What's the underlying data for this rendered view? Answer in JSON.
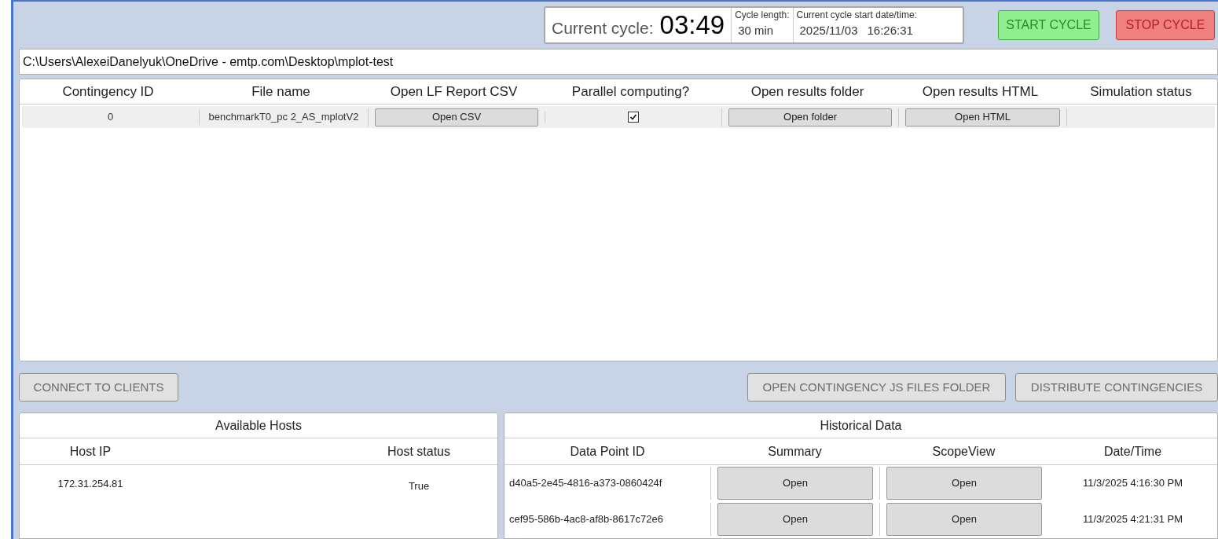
{
  "cycle": {
    "label": "Current cycle:",
    "timer": "03:49",
    "length_label": "Cycle length:",
    "length": "30 min",
    "start_label": "Current cycle start date/time:",
    "start_date": "2025/11/03",
    "start_time": "16:26:31"
  },
  "buttons": {
    "start": "START CYCLE",
    "stop": "STOP CYCLE"
  },
  "path": "C:\\Users\\AlexeiDanelyuk\\OneDrive - emtp.com\\Desktop\\mplot-test",
  "contingency_table": {
    "columns": [
      "Contingency ID",
      "File name",
      "Open LF Report CSV",
      "Parallel computing?",
      "Open results folder",
      "Open results HTML",
      "Simulation status"
    ],
    "rows": [
      {
        "id": "0",
        "file": "benchmarkT0_pc 2_AS_mplotV2",
        "csv_button": "Open CSV",
        "parallel": true,
        "folder_button": "Open folder",
        "html_button": "Open HTML"
      }
    ]
  },
  "actions": {
    "connect": "CONNECT TO CLIENTS",
    "open_js": "OPEN CONTINGENCY JS FILES FOLDER",
    "distribute": "DISTRIBUTE CONTINGENCIES"
  },
  "hosts": {
    "title": "Available Hosts",
    "columns": [
      "Host IP",
      "Host status"
    ],
    "rows": [
      {
        "ip": "172.31.254.81",
        "status": "True"
      }
    ]
  },
  "history": {
    "title": "Historical Data",
    "columns": [
      "Data Point ID",
      "Summary",
      "ScopeView",
      "Date/Time"
    ],
    "rows": [
      {
        "id": "d40a5-2e45-4816-a373-0860424f",
        "summary": "Open",
        "scope": "Open",
        "time": "11/3/2025 4:16:30 PM"
      },
      {
        "id": "cef95-586b-4ac8-af8b-8617c72e6",
        "summary": "Open",
        "scope": "Open",
        "time": "11/3/2025 4:21:31 PM"
      }
    ]
  }
}
